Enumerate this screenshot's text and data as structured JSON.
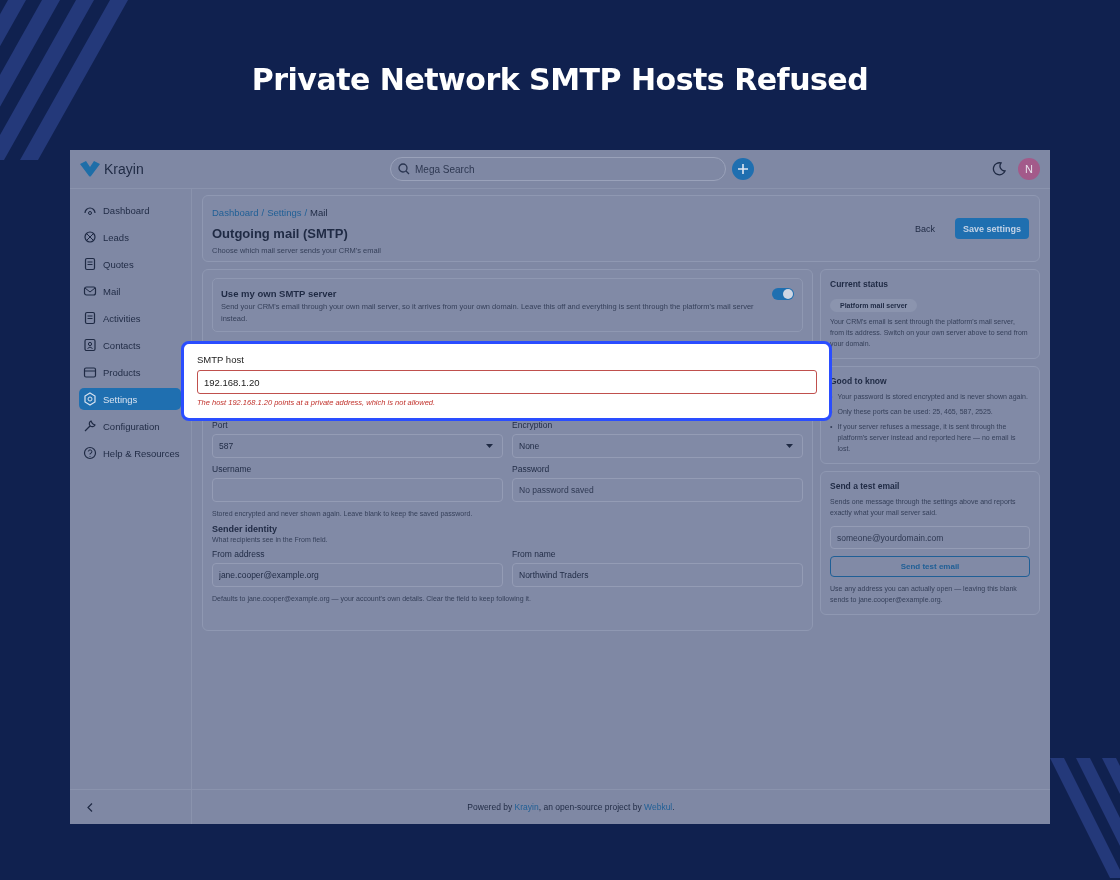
{
  "headline": "Private Network SMTP Hosts Refused",
  "app": {
    "logo": "Krayin",
    "search": {
      "placeholder": "Mega Search"
    },
    "user_initial": "N",
    "sidebar": [
      {
        "label": "Dashboard",
        "selected": false
      },
      {
        "label": "Leads",
        "selected": false
      },
      {
        "label": "Quotes",
        "selected": false
      },
      {
        "label": "Mail",
        "selected": false
      },
      {
        "label": "Activities",
        "selected": false
      },
      {
        "label": "Contacts",
        "selected": false
      },
      {
        "label": "Products",
        "selected": false
      },
      {
        "label": "Settings",
        "selected": true
      },
      {
        "label": "Configuration",
        "selected": false
      },
      {
        "label": "Help & Resources",
        "selected": false
      }
    ],
    "breadcrumb_separator": "/",
    "breadcrumb": [
      {
        "label": "Dashboard",
        "link": true
      },
      {
        "label": "Settings",
        "link": true
      },
      {
        "label": "Mail",
        "link": false
      }
    ],
    "title": "Outgoing mail (SMTP)",
    "subtitle": "Choose which mail server sends your CRM's email",
    "back_button": "Back",
    "save_button": "Save settings",
    "toggle": {
      "title": "Use my own SMTP server",
      "description": "Send your CRM's email through your own mail server, so it arrives from your own domain. Leave this off and everything is sent through the platform's mail server instead.",
      "on": true
    },
    "fields": [
      {
        "label": "Port",
        "kind": "select",
        "value": "587"
      },
      {
        "label": "Encryption",
        "kind": "select",
        "value": "None"
      },
      {
        "label": "Username",
        "kind": "text"
      },
      {
        "label": "Password",
        "kind": "text",
        "placeholder": "No password saved"
      }
    ],
    "password_hint": "Stored encrypted and never shown again. Leave blank to keep the saved password.",
    "sender": {
      "title": "Sender identity",
      "subtitle": "What recipients see in the From field.",
      "fields": [
        {
          "label": "From address",
          "value": "jane.cooper@example.org"
        },
        {
          "label": "From name",
          "value": "Northwind Traders"
        }
      ],
      "hint": "Defaults to jane.cooper@example.org — your account's own details. Clear the field to keep following it."
    },
    "status": {
      "title": "Current status",
      "badge": "Platform mail server",
      "text": "Your CRM's email is sent through the platform's mail server, from its address. Switch on your own server above to send from your domain."
    },
    "good_to_know": {
      "title": "Good to know",
      "bullet": "•",
      "items": [
        "Your password is stored encrypted and is never shown again.",
        "Only these ports can be used: 25, 465, 587, 2525.",
        "If your server refuses a message, it is sent through the platform's server instead and reported here — no email is lost."
      ]
    },
    "test_email": {
      "title": "Send a test email",
      "text": "Sends one message through the settings above and reports exactly what your mail server said.",
      "placeholder": "someone@yourdomain.com",
      "button": "Send test email",
      "note": "Use any address you can actually open — leaving this blank sends to jane.cooper@example.org."
    },
    "footer": {
      "before": "Powered by ",
      "link": "Krayin",
      "middle": ", an open-source project by ",
      "link2": "Webkul",
      "after": "."
    }
  },
  "callout": {
    "label": "SMTP host",
    "value": "192.168.1.20",
    "error": "The host 192.168.1.20 points at a private address, which is not allowed."
  }
}
